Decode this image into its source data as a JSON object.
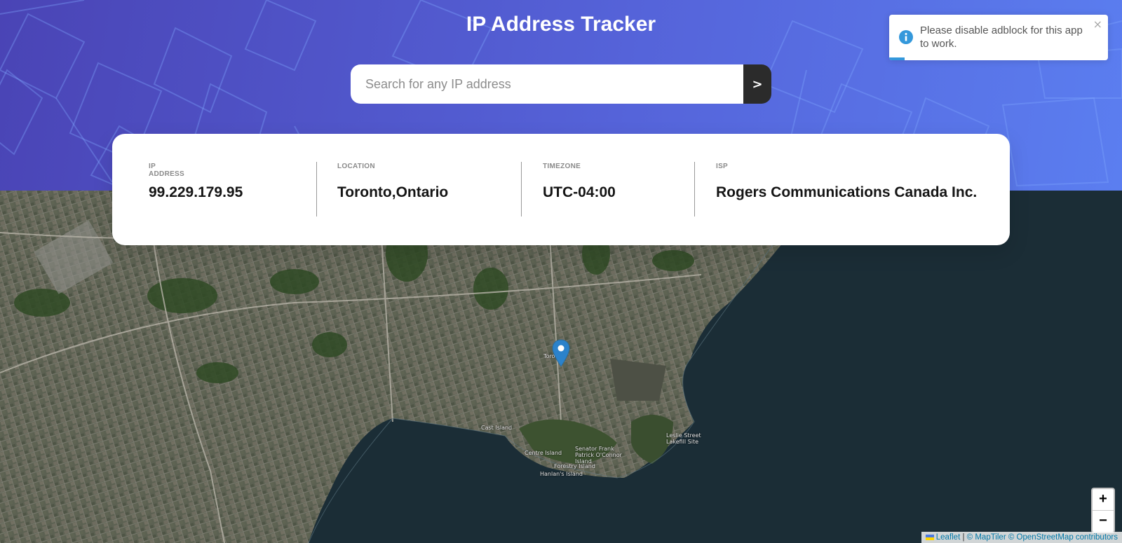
{
  "header": {
    "title": "IP Address Tracker",
    "search": {
      "placeholder": "Search for any IP address",
      "value": "",
      "submit_label": ">"
    }
  },
  "info": [
    {
      "label": "IP ADDRESS",
      "value": "99.229.179.95"
    },
    {
      "label": "LOCATION",
      "value": "Toronto,Ontario"
    },
    {
      "label": "TIMEZONE",
      "value": "UTC-04:00"
    },
    {
      "label": "ISP",
      "value": "Rogers Communications Canada Inc."
    }
  ],
  "map": {
    "labels": {
      "city": "Toronto",
      "island1": "Centre Island",
      "island2": "Senator Frank Patrick O'Connor Island",
      "island3": "Forestry Island",
      "island4": "Hanlan's Island",
      "island5": "Leslie Street Lakefill Site",
      "island6": "Cast Island"
    },
    "zoom_in": "+",
    "zoom_out": "−",
    "attribution": {
      "leaflet": "Leaflet",
      "maptiler": "© MapTiler",
      "osm": "© OpenStreetMap contributors"
    },
    "marker_icon": "map-pin-icon"
  },
  "toast": {
    "icon": "info-icon",
    "message": "Please disable adblock for this app to work.",
    "close": "×",
    "progress_fraction": 0.07
  },
  "colors": {
    "header_start": "#4a44b5",
    "header_end": "#5b7ef0",
    "water": "#1b2d36",
    "toast_accent": "#3498db"
  }
}
